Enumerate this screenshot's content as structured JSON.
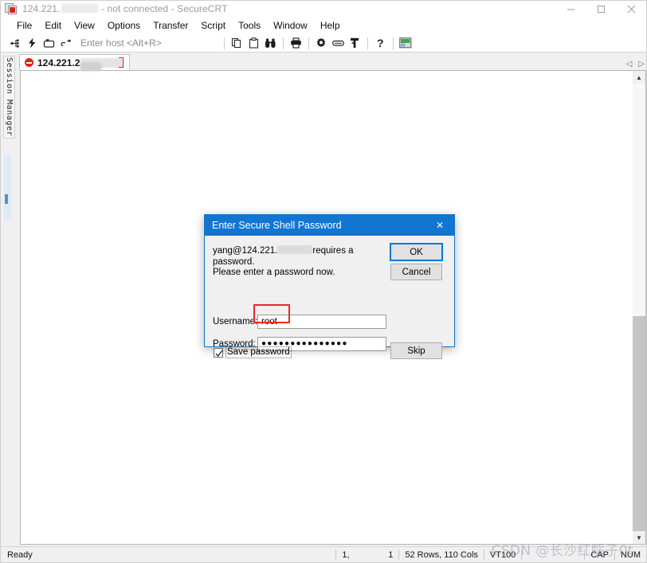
{
  "window": {
    "title_prefix": "124.221.",
    "title_suffix": " - not connected - SecureCRT",
    "app_icon": "securecrt-icon",
    "minimize": "–",
    "maximize": "□",
    "close": "✕"
  },
  "menubar": {
    "items": [
      {
        "label": "File"
      },
      {
        "label": "Edit"
      },
      {
        "label": "View"
      },
      {
        "label": "Options"
      },
      {
        "label": "Transfer"
      },
      {
        "label": "Script"
      },
      {
        "label": "Tools"
      },
      {
        "label": "Window"
      },
      {
        "label": "Help"
      }
    ]
  },
  "toolbar": {
    "host_placeholder": "Enter host <Alt+R>",
    "buttons": [
      {
        "name": "new-session-icon",
        "glyph": "connect"
      },
      {
        "name": "quick-connect-icon",
        "glyph": "lightning"
      },
      {
        "name": "connect-in-tab-icon",
        "glyph": "tab"
      },
      {
        "name": "reconnect-icon",
        "glyph": "reconnect"
      },
      {
        "name": "copy-icon",
        "glyph": "copy"
      },
      {
        "name": "paste-icon",
        "glyph": "paste"
      },
      {
        "name": "find-icon",
        "glyph": "binoculars"
      },
      {
        "name": "print-icon",
        "glyph": "printer"
      },
      {
        "name": "session-options-icon",
        "glyph": "gear"
      },
      {
        "name": "keymap-editor-icon",
        "glyph": "keyboard"
      },
      {
        "name": "filter-icon",
        "glyph": "key"
      },
      {
        "name": "help-icon",
        "glyph": "question"
      },
      {
        "name": "arrange-icon",
        "glyph": "window"
      }
    ]
  },
  "sidebar": {
    "session_manager_label": "Session Manager"
  },
  "tabs": {
    "scroll_left": "◁",
    "scroll_right": "▷",
    "items": [
      {
        "label": "124.221.2",
        "status": "disconnected",
        "status_color": "#e02020"
      }
    ]
  },
  "dialog": {
    "title": "Enter Secure Shell Password",
    "close_label": "✕",
    "message_prefix": "yang@124.221.",
    "message_suffix": "requires a password.",
    "message_line2": "Please enter a password now.",
    "username_label": "Username:",
    "username_value": "root",
    "password_label": "Password:",
    "password_value": "●●●●●●●●●●●●●●●",
    "save_password_label": "Save password",
    "save_password_checked": true,
    "ok_label": "OK",
    "cancel_label": "Cancel",
    "skip_label": "Skip",
    "accent_color": "#1275d1",
    "highlight_color": "#ee2727"
  },
  "statusbar": {
    "ready": "Ready",
    "cursor_row": "1,",
    "cursor_col": "1",
    "dimensions": "52 Rows, 110 Cols",
    "emulation": "VT100",
    "caps": "CAP",
    "num": "NUM"
  },
  "watermark": {
    "text": "CSDN @长沙红睬子0t"
  }
}
